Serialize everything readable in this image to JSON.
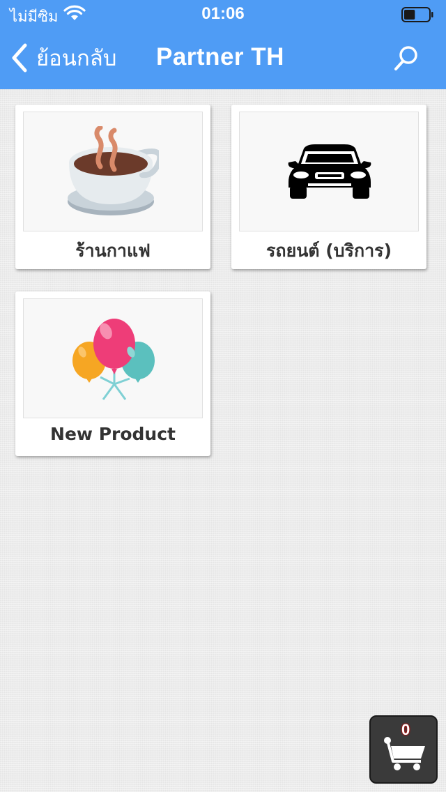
{
  "status_bar": {
    "carrier": "ไม่มีซิม",
    "time": "01:06",
    "battery_level": 0.45
  },
  "nav": {
    "back_label": "ย้อนกลับ",
    "title": "Partner TH",
    "icons": [
      "chevron-left-icon",
      "search-icon"
    ]
  },
  "theme": {
    "nav_bg": "#4f9cf5",
    "card_bg": "#ffffff",
    "cart_bg": "#3a3a3a"
  },
  "categories": [
    {
      "label": "ร้านกาแฟ",
      "icon": "coffee-cup-icon"
    },
    {
      "label": "รถยนต์ (บริการ)",
      "icon": "car-icon"
    },
    {
      "label": "New Product",
      "icon": "balloons-icon"
    }
  ],
  "cart": {
    "count": "0",
    "icon": "shopping-cart-icon"
  }
}
